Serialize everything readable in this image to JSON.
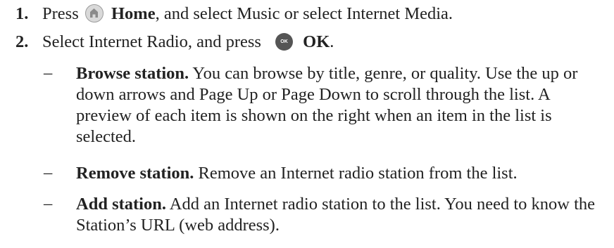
{
  "steps": [
    {
      "number": "1.",
      "text_before": "Press",
      "icon": "home-icon",
      "bold": "Home",
      "text_after": ", and select Music or select Internet Media."
    },
    {
      "number": "2.",
      "text_before": "Select Internet Radio, and press",
      "icon": "ok-icon",
      "icon_label": "OK",
      "bold": "OK",
      "text_after": "."
    }
  ],
  "bullets": [
    {
      "dash": "–",
      "title": "Browse station.",
      "body": " You can browse by title, genre, or quality. Use the up or down arrows and Page Up or Page Down to scroll through the list. A preview of each item is shown on the right when an item in the list is selected."
    },
    {
      "dash": "–",
      "title": "Remove station.",
      "body": " Remove an Internet radio station from the list."
    },
    {
      "dash": "–",
      "title": "Add station.",
      "body": " Add an Internet radio station to the list. You need to know the Station’s URL (web address)."
    }
  ],
  "colors": {
    "text": "#222222",
    "home_icon_bg": "#d9d9d9",
    "ok_icon_bg": "#555555"
  }
}
